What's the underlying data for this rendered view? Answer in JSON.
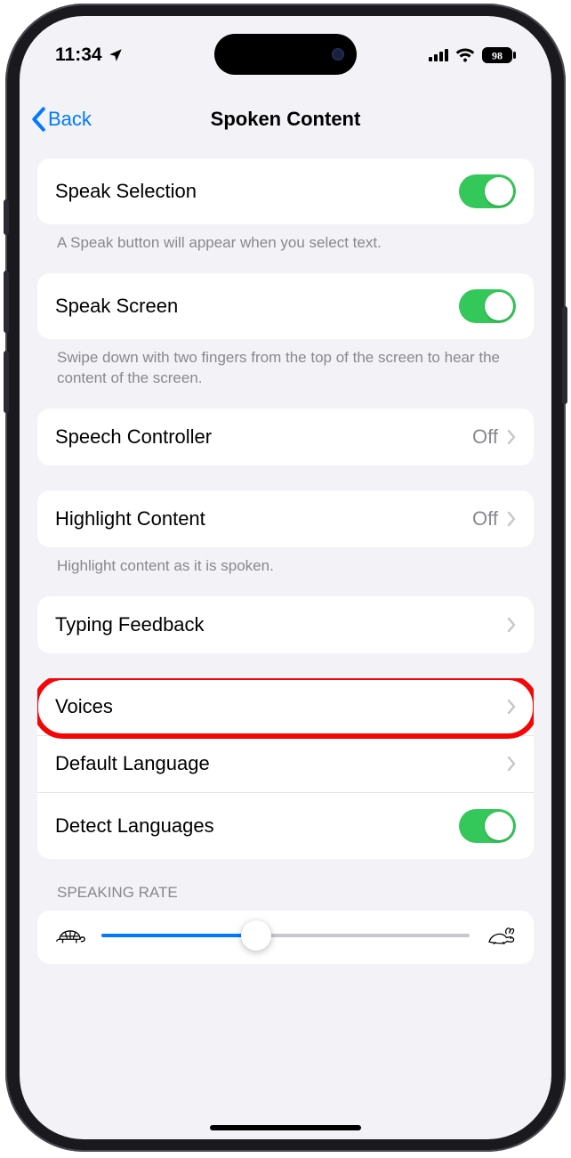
{
  "status": {
    "time": "11:34",
    "battery": "98"
  },
  "nav": {
    "back": "Back",
    "title": "Spoken Content"
  },
  "rows": {
    "speak_selection": "Speak Selection",
    "speak_selection_footer": "A Speak button will appear when you select text.",
    "speak_screen": "Speak Screen",
    "speak_screen_footer": "Swipe down with two fingers from the top of the screen to hear the content of the screen.",
    "speech_controller": "Speech Controller",
    "speech_controller_val": "Off",
    "highlight_content": "Highlight Content",
    "highlight_content_val": "Off",
    "highlight_content_footer": "Highlight content as it is spoken.",
    "typing_feedback": "Typing Feedback",
    "voices": "Voices",
    "default_language": "Default Language",
    "detect_languages": "Detect Languages"
  },
  "speaking_rate_header": "SPEAKING RATE",
  "slider_value_pct": 42,
  "toggles": {
    "speak_selection": true,
    "speak_screen": true,
    "detect_languages": true
  },
  "highlighted_row": "voices"
}
